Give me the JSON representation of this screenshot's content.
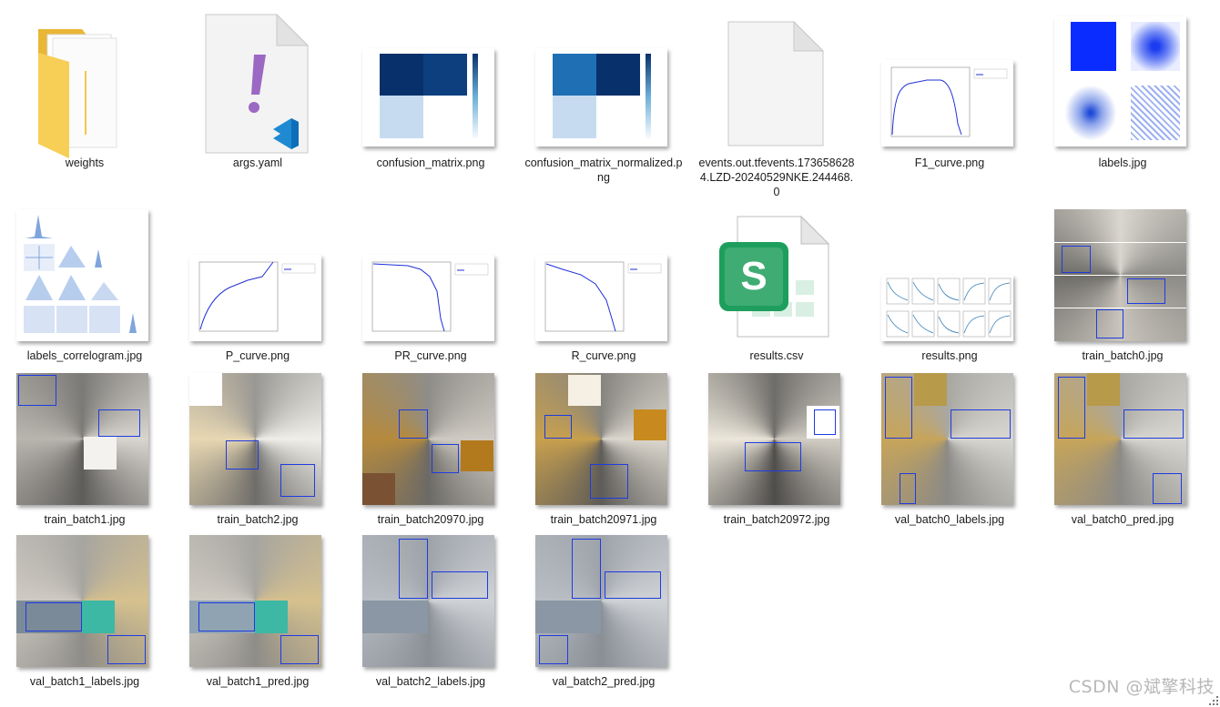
{
  "files": [
    {
      "id": "weights",
      "name": "weights",
      "kind": "folder",
      "icon": "folder-icon"
    },
    {
      "id": "args",
      "name": "args.yaml",
      "kind": "yaml",
      "icon": "yaml-file-icon"
    },
    {
      "id": "cm",
      "name": "confusion_matrix.png",
      "kind": "matrix"
    },
    {
      "id": "cmn",
      "name": "confusion_matrix_normalized.png",
      "kind": "matrix"
    },
    {
      "id": "events",
      "name": "events.out.tfevents.1736586284.LZD-20240529NKE.244468.0",
      "kind": "blank",
      "icon": "blank-file-icon"
    },
    {
      "id": "f1",
      "name": "F1_curve.png",
      "kind": "curve"
    },
    {
      "id": "labels",
      "name": "labels.jpg",
      "kind": "labels"
    },
    {
      "id": "corr",
      "name": "labels_correlogram.jpg",
      "kind": "correlogram"
    },
    {
      "id": "p",
      "name": "P_curve.png",
      "kind": "curve"
    },
    {
      "id": "pr",
      "name": "PR_curve.png",
      "kind": "curve"
    },
    {
      "id": "r",
      "name": "R_curve.png",
      "kind": "curve"
    },
    {
      "id": "csv",
      "name": "results.csv",
      "kind": "csv",
      "icon": "spreadsheet-file-icon",
      "icon_letter": "S"
    },
    {
      "id": "res",
      "name": "results.png",
      "kind": "results"
    },
    {
      "id": "tb0",
      "name": "train_batch0.jpg",
      "kind": "mosaic"
    },
    {
      "id": "tb1",
      "name": "train_batch1.jpg",
      "kind": "mosaic"
    },
    {
      "id": "tb2",
      "name": "train_batch2.jpg",
      "kind": "mosaic"
    },
    {
      "id": "tb20970",
      "name": "train_batch20970.jpg",
      "kind": "mosaic"
    },
    {
      "id": "tb20971",
      "name": "train_batch20971.jpg",
      "kind": "mosaic"
    },
    {
      "id": "tb20972",
      "name": "train_batch20972.jpg",
      "kind": "mosaic"
    },
    {
      "id": "vb0l",
      "name": "val_batch0_labels.jpg",
      "kind": "mosaic"
    },
    {
      "id": "vb0p",
      "name": "val_batch0_pred.jpg",
      "kind": "mosaic"
    },
    {
      "id": "vb1l",
      "name": "val_batch1_labels.jpg",
      "kind": "mosaic"
    },
    {
      "id": "vb1p",
      "name": "val_batch1_pred.jpg",
      "kind": "mosaic"
    },
    {
      "id": "vb2l",
      "name": "val_batch2_labels.jpg",
      "kind": "mosaic"
    },
    {
      "id": "vb2p",
      "name": "val_batch2_pred.jpg",
      "kind": "mosaic"
    }
  ],
  "watermark": "CSDN @斌擎科技",
  "colors": {
    "matrix_dark": "#08306b",
    "matrix_mid": "#1f6fb4",
    "matrix_light": "#c6dbef",
    "curve": "#1f2fd6",
    "bbox": "#1f3be0",
    "folder": "#f4c64a"
  }
}
